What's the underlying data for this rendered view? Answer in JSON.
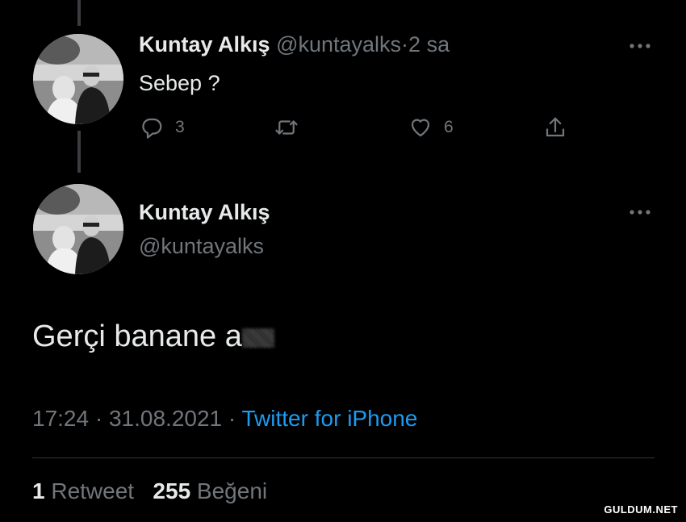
{
  "reply_tweet": {
    "display_name": "Kuntay Alkış",
    "handle": "@kuntayalks",
    "separator": "·",
    "time_ago": "2 sa",
    "text": "Sebep ?",
    "reply_count": "3",
    "like_count": "6"
  },
  "main_tweet": {
    "display_name": "Kuntay Alkış",
    "handle": "@kuntayalks",
    "text": "Gerçi banane a",
    "time": "17:24",
    "separator": "·",
    "date": "31.08.2021",
    "source": "Twitter for iPhone",
    "retweet_count": "1",
    "retweet_label": "Retweet",
    "like_count": "255",
    "like_label": "Beğeni"
  },
  "watermark": "GULDUM.NET",
  "colors": {
    "background": "#000000",
    "primary_text": "#e7e9ea",
    "secondary_text": "#71767b",
    "link": "#1d9bf0"
  }
}
